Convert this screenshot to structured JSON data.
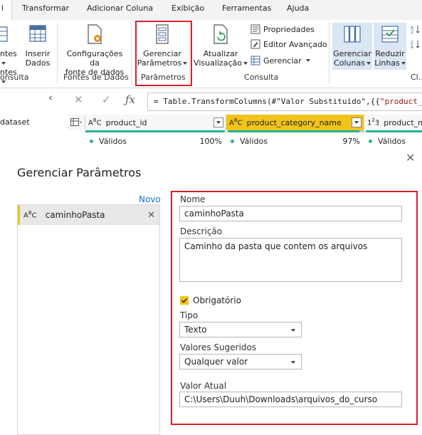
{
  "tabs": [
    {
      "label": "l",
      "active": true
    },
    {
      "label": "Transformar"
    },
    {
      "label": "Adicionar Coluna"
    },
    {
      "label": "Exibição"
    },
    {
      "label": "Ferramentas"
    },
    {
      "label": "Ajuda"
    }
  ],
  "ribbon": {
    "fontes_partial_line1": "ntes",
    "fontes_partial_line2": "ntes",
    "inserir_line1": "Inserir",
    "inserir_line2": "Dados",
    "config_line1": "Configurações da",
    "config_line2": "fonte de dados",
    "gerenciar_line1": "Gerenciar",
    "gerenciar_line2": "Parâmetros",
    "atualizar_line1": "Atualizar",
    "atualizar_line2": "Visualização",
    "propriedades": "Propriedades",
    "editor_avancado": "Editor Avançado",
    "gerenciar_small": "Gerenciar",
    "gerenciar_colunas_line1": "Gerenciar",
    "gerenciar_colunas_line2": "Colunas",
    "reduzir_line1": "Reduzir",
    "reduzir_line2": "Linhas",
    "cl_partial": "Cl...",
    "group_consulta_partial": "onsulta",
    "group_fontes": "Fontes de Dados",
    "group_parametros": "Parâmetros",
    "group_consulta": "Consulta"
  },
  "formula": {
    "prefix": "= Table.TransformColumns(#\"Valor Substituído\",{{",
    "string_part": "\"product_"
  },
  "side": {
    "dataset_partial": "dataset"
  },
  "grid": {
    "columns": [
      {
        "type_icon": "ABC",
        "name": "product_id",
        "quality_label": "Válidos",
        "quality_pct": "100%"
      },
      {
        "type_icon": "ABC",
        "name": "product_category_name",
        "quality_label": "Válidos",
        "quality_pct": "97%",
        "selected": true
      },
      {
        "type_icon": "123",
        "name": "product_na",
        "quality_label": "Válidos",
        "quality_pct": ""
      }
    ]
  },
  "dialog": {
    "title": "Gerenciar Parâmetros",
    "novo": "Novo",
    "parameter_item": "caminhoPasta",
    "parameter_type_icon": "ABC",
    "nome_label": "Nome",
    "nome_value": "caminhoPasta",
    "descricao_label": "Descrição",
    "descricao_value": "Caminho da pasta que contem os arquivos",
    "obrigatorio_label": "Obrigatório",
    "obrigatorio_checked": true,
    "tipo_label": "Tipo",
    "tipo_value": "Texto",
    "valores_label": "Valores Sugeridos",
    "valores_value": "Qualquer valor",
    "valor_atual_label": "Valor Atual",
    "valor_atual_value": "C:\\Users\\Duuh\\Downloads\\arquivos_do_curso"
  },
  "colors": {
    "highlight_red": "#d8202a",
    "accent_yellow": "#f0c419",
    "quality_green": "#28b29a",
    "link_blue": "#1a6fc4"
  }
}
